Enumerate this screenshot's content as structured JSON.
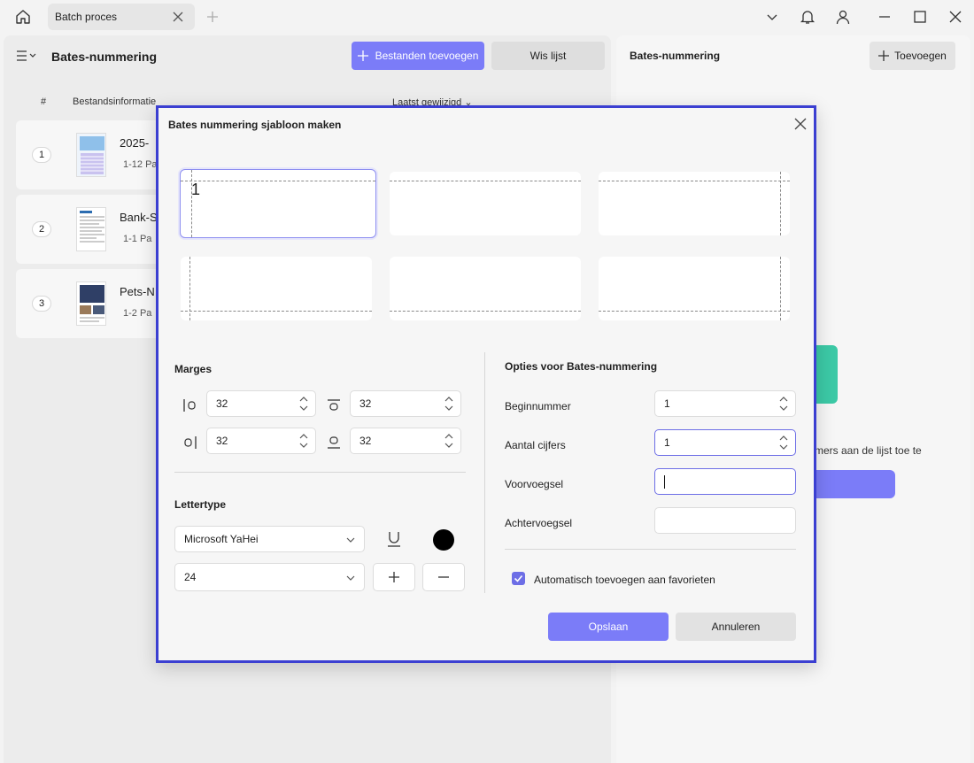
{
  "titlebar": {
    "tab_label": "Batch proces",
    "icons": [
      "home-icon",
      "close-icon",
      "plus-icon",
      "chevron-down-icon",
      "bell-icon",
      "user-icon",
      "minimize-icon",
      "maximize-icon",
      "close-window-icon"
    ]
  },
  "left_panel": {
    "title": "Bates-nummering",
    "add_files_label": "Bestanden toevoegen",
    "clear_list_label": "Wis lijst",
    "columns": {
      "num": "#",
      "info": "Bestandsinformatie",
      "modified": "Laatst gewijzigd"
    },
    "files": [
      {
        "num": "1",
        "name": "2025-",
        "meta": "1-12 Pa"
      },
      {
        "num": "2",
        "name": "Bank-S",
        "meta": "1-1 Pa"
      },
      {
        "num": "3",
        "name": "Pets-N",
        "meta": "1-2 Pa"
      }
    ]
  },
  "right_panel": {
    "title": "Bates-nummering",
    "add_label": "Toevoegen",
    "hint_text": "mers aan de lijst toe te"
  },
  "dialog": {
    "title": "Bates nummering sjabloon maken",
    "position_preview_text": "1",
    "margins": {
      "title": "Marges",
      "left": "32",
      "top": "32",
      "right": "32",
      "bottom": "32"
    },
    "font": {
      "title": "Lettertype",
      "family": "Microsoft YaHei",
      "size": "24",
      "color": "#000000"
    },
    "options": {
      "title": "Opties voor Bates-nummering",
      "start_number_label": "Beginnummer",
      "start_number": "1",
      "digits_label": "Aantal cijfers",
      "digits": "1",
      "prefix_label": "Voorvoegsel",
      "prefix": "",
      "suffix_label": "Achtervoegsel",
      "suffix": "",
      "auto_add_label": "Automatisch toevoegen aan favorieten",
      "auto_add_checked": true
    },
    "save_label": "Opslaan",
    "cancel_label": "Annuleren"
  },
  "colors": {
    "accent": "#7b7cf8",
    "focus": "#3b3fd1",
    "teal": "#3cc9a6"
  }
}
